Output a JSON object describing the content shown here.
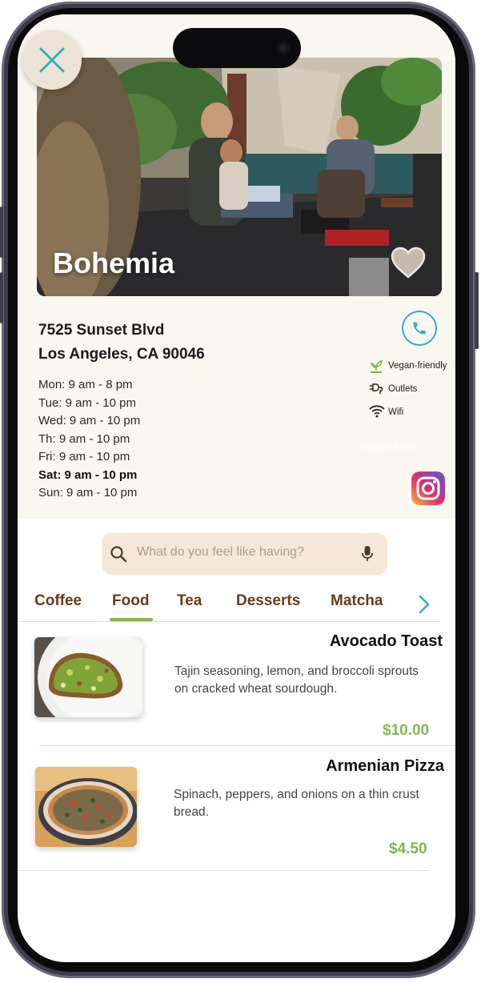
{
  "cafe": {
    "name": "Bohemia",
    "address_line1": "7525 Sunset Blvd",
    "address_line2": "Los Angeles, CA 90046",
    "hours": [
      {
        "text": "Mon: 9 am - 8 pm",
        "today": false
      },
      {
        "text": "Tue: 9 am - 10 pm",
        "today": false
      },
      {
        "text": "Wed: 9 am - 10 pm",
        "today": false
      },
      {
        "text": "Th: 9 am - 10 pm",
        "today": false
      },
      {
        "text": "Fri: 9 am - 10 pm",
        "today": false
      },
      {
        "text": "Sat: 9 am - 10 pm",
        "today": true
      },
      {
        "text": "Sun: 9 am - 10 pm",
        "today": false
      }
    ],
    "amenities": [
      {
        "label": "Vegan-friendly",
        "icon": "vegan-icon"
      },
      {
        "label": "Outlets",
        "icon": "outlet-icon"
      },
      {
        "label": "Wifi",
        "icon": "wifi-icon"
      }
    ],
    "suggest_info": "Suggest info"
  },
  "search": {
    "placeholder": "What do you feel like having?"
  },
  "tabs": [
    {
      "label": "Coffee",
      "active": false
    },
    {
      "label": "Food",
      "active": true
    },
    {
      "label": "Tea",
      "active": false
    },
    {
      "label": "Desserts",
      "active": false
    },
    {
      "label": "Matcha",
      "active": false
    }
  ],
  "menu": [
    {
      "title": "Avocado Toast",
      "description_line1": "Tajin seasoning, lemon, and broccoli sprouts",
      "description_line2": "on cracked wheat sourdough.",
      "price": "$10.00"
    },
    {
      "title": "Armenian Pizza",
      "description_line1": "Spinach, peppers, and onions on a thin crust",
      "description_line2": "bread.",
      "price": "$4.50"
    }
  ],
  "colors": {
    "accent_green": "#86b454",
    "brown": "#6b3a17",
    "teal": "#2eb0c3",
    "cream": "#faf6f0"
  }
}
